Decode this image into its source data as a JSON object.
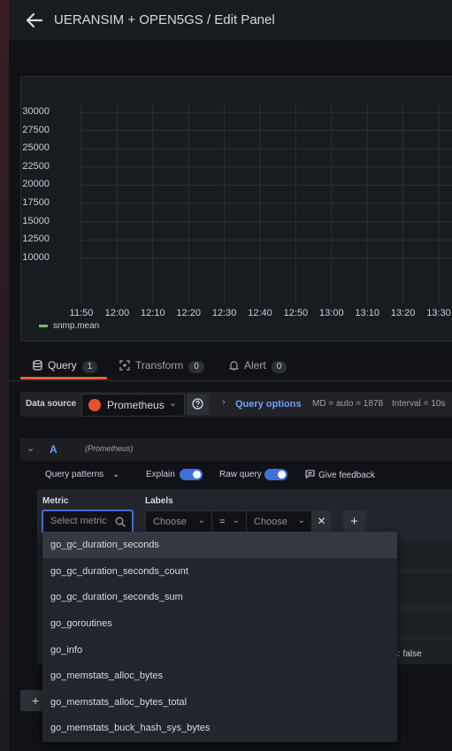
{
  "header": {
    "title": "UERANSIM + OPEN5GS / Edit Panel"
  },
  "chart_data": {
    "type": "line",
    "y_ticks": [
      "30000",
      "27500",
      "25000",
      "22500",
      "20000",
      "17500",
      "15000",
      "12500",
      "10000"
    ],
    "x_ticks": [
      "11:50",
      "12:00",
      "12:10",
      "12:20",
      "12:30",
      "12:40",
      "12:50",
      "13:00",
      "13:10",
      "13:20",
      "13:30"
    ],
    "ylim": [
      10000,
      30000
    ],
    "grid": true,
    "series": [
      {
        "name": "snmp.mean",
        "values": [],
        "color": "#73bf69"
      }
    ],
    "legend": "bottom-left"
  },
  "tabs": [
    {
      "label": "Query",
      "count": "1"
    },
    {
      "label": "Transform",
      "count": "0"
    },
    {
      "label": "Alert",
      "count": "0"
    }
  ],
  "datasource": {
    "label": "Data source",
    "name": "Prometheus",
    "query_options_label": "Query options",
    "md": "MD = auto = 1878",
    "interval": "Interval = 10s"
  },
  "query": {
    "letter": "A",
    "datasource": "(Prometheus)",
    "patterns_label": "Query patterns",
    "explain_label": "Explain",
    "raw_query_label": "Raw query",
    "feedback_label": "Give feedback"
  },
  "builder": {
    "metric_label": "Metric",
    "labels_label": "Labels",
    "metric_placeholder": "Select metric",
    "label_key_placeholder": "Choose",
    "operator": "=",
    "label_value_placeholder": "Choose",
    "remove_glyph": "✕",
    "add_glyph": "+",
    "peek_text": "s: false",
    "add_query_glyph": "+"
  },
  "metric_options": [
    "go_gc_duration_seconds",
    "go_gc_duration_seconds_count",
    "go_gc_duration_seconds_sum",
    "go_goroutines",
    "go_info",
    "go_memstats_alloc_bytes",
    "go_memstats_alloc_bytes_total",
    "go_memstats_buck_hash_sys_bytes"
  ],
  "colors": {
    "accent": "#3d71d9",
    "tab_active": "#f55f3e",
    "series": "#73bf69",
    "prometheus": "#e6522c"
  }
}
